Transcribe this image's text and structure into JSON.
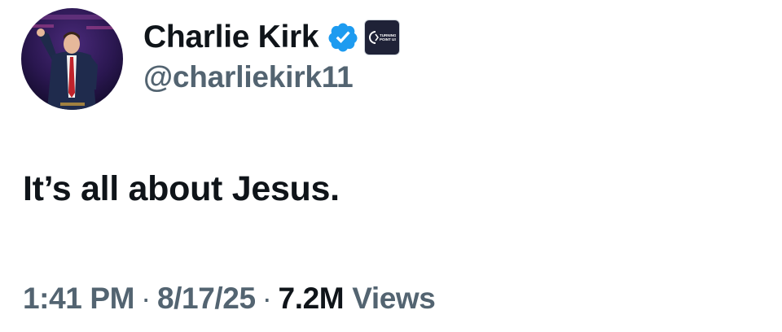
{
  "author": {
    "display_name": "Charlie Kirk",
    "handle": "@charliekirk11",
    "verified": true,
    "verified_color": "#1d9bf0",
    "affiliate_badge": "turning-point-usa-logo",
    "affiliate_badge_text": "TURNING POINT USA"
  },
  "tweet": {
    "text": "It’s all about Jesus."
  },
  "meta": {
    "time": "1:41 PM",
    "separator": "·",
    "date": "8/17/25",
    "views_count": "7.2M",
    "views_label": "Views"
  },
  "colors": {
    "primary_text": "#0f1419",
    "secondary_text": "#536471",
    "background": "#ffffff"
  }
}
